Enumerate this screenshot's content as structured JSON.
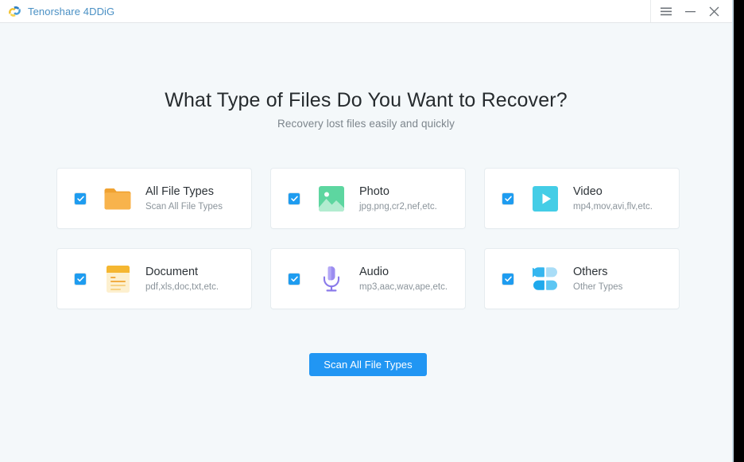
{
  "window": {
    "app_title": "Tenorshare 4DDiG",
    "logo_icon": "tenorshare-swirl-logo",
    "controls": {
      "menu_icon": "hamburger-menu-icon",
      "minimize_icon": "minimize-icon",
      "close_icon": "close-icon"
    },
    "colors": {
      "titlebar_bg": "#ffffff",
      "page_bg": "#f4f8fa",
      "brand_blue": "#4a90c4",
      "accent_blue": "#2196f3",
      "checkbox_blue": "#1e9cf0"
    }
  },
  "main": {
    "heading": "What Type of Files Do You Want to Recover?",
    "subheading": "Recovery lost files easily and quickly",
    "cards": [
      {
        "title": "All File Types",
        "subtitle": "Scan All File Types",
        "icon": "folder-icon",
        "icon_color": "#f5a623",
        "checked": true
      },
      {
        "title": "Photo",
        "subtitle": "jpg,png,cr2,nef,etc.",
        "icon": "photo-image-icon",
        "icon_color": "#52d6a0",
        "checked": true
      },
      {
        "title": "Video",
        "subtitle": "mp4,mov,avi,flv,etc.",
        "icon": "video-play-icon",
        "icon_color": "#45cde4",
        "checked": true
      },
      {
        "title": "Document",
        "subtitle": "pdf,xls,doc,txt,etc.",
        "icon": "document-icon",
        "icon_color": "#f5b731",
        "checked": true
      },
      {
        "title": "Audio",
        "subtitle": "mp3,aac,wav,ape,etc.",
        "icon": "microphone-icon",
        "icon_color": "#9b8cf0",
        "checked": true
      },
      {
        "title": "Others",
        "subtitle": "Other Types",
        "icon": "others-clover-icon",
        "icon_color": "#35b6ef",
        "checked": true
      }
    ],
    "scan_button_label": "Scan All File Types"
  }
}
